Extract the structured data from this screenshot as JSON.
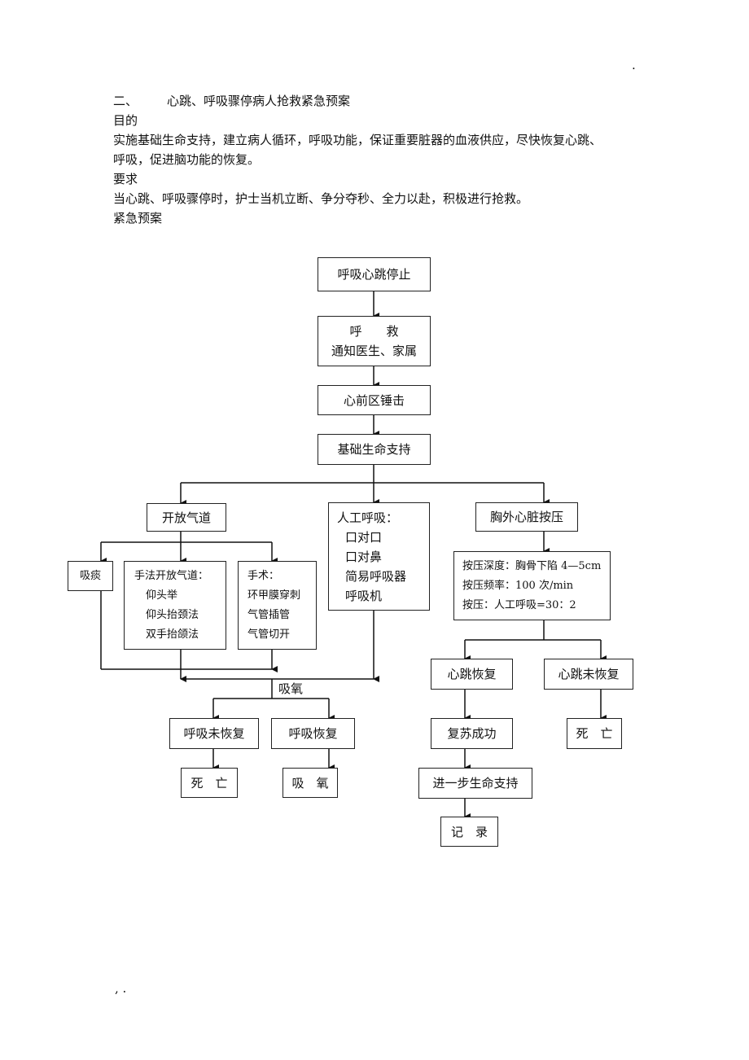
{
  "page_marks": {
    "top_dot": ".",
    "bottom_mark": ", ."
  },
  "heading": {
    "number": "二、",
    "title": "心跳、呼吸骤停病人抢救紧急预案"
  },
  "sections": [
    {
      "label": "目的",
      "text_lines": [
        "实施基础生命支持，建立病人循环，呼吸功能，保证重要脏器的血液供应，尽快恢复心跳、",
        "呼吸，促进脑功能的恢复。"
      ]
    },
    {
      "label": "要求",
      "text_lines": [
        "当心跳、呼吸骤停时，护士当机立断、争分夺秒、全力以赴，积极进行抢救。"
      ]
    },
    {
      "label": "紧急预案"
    }
  ],
  "flow": {
    "stop": "呼吸心跳停止",
    "call": [
      "呼　　救",
      "通知医生、家属"
    ],
    "thump": "心前区锤击",
    "bls": "基础生命支持",
    "airway": "开放气道",
    "ventilation": [
      "人工呼吸：",
      "口对口",
      "口对鼻",
      "简易呼吸器",
      "呼吸机"
    ],
    "compression": "胸外心脏按压",
    "compression_detail": [
      "按压深度：胸骨下陷 4—5cm",
      "按压频率：100 次/min",
      "按压：人工呼吸=30：2"
    ],
    "suction": "吸痰",
    "manual": [
      "手法开放气道：",
      "仰头举",
      "仰头抬颈法",
      "双手抬颌法"
    ],
    "surgery": [
      "手术：",
      "环甲膜穿刺",
      "气管插管",
      "气管切开"
    ],
    "oxygen_label": "吸氧",
    "breath_not_recovered": "呼吸未恢复",
    "breath_recovered": "呼吸恢复",
    "death1": "死　亡",
    "oxygen": "吸　氧",
    "heart_recovered": "心跳恢复",
    "heart_not_recovered": "心跳未恢复",
    "resus_success": "复苏成功",
    "death2": "死　亡",
    "further": "进一步生命支持",
    "record": "记　录"
  }
}
